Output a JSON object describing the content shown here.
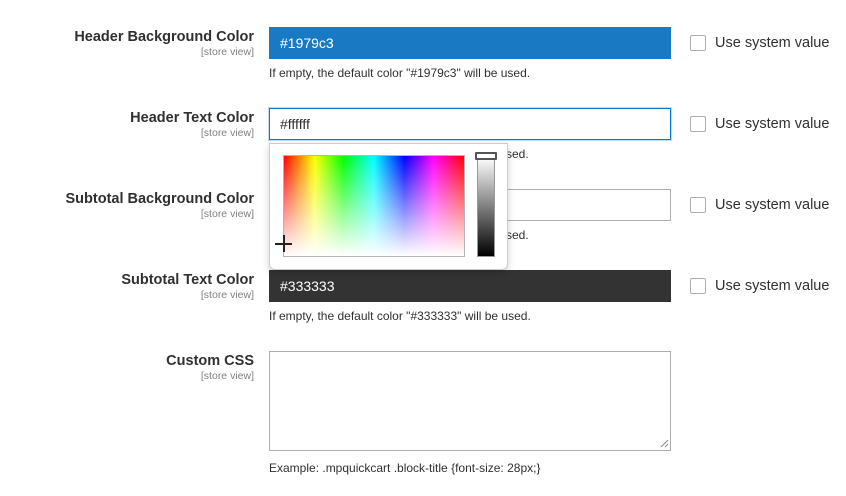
{
  "fields": [
    {
      "label": "Header Background Color",
      "scope": "[store view]",
      "value": "#1979c3",
      "note": "If empty, the default color \"#1979c3\" will be used.",
      "system_value_label": "Use system value"
    },
    {
      "label": "Header Text Color",
      "scope": "[store view]",
      "value": "#ffffff",
      "note_visible": "sed.",
      "system_value_label": "Use system value"
    },
    {
      "label": "Subtotal Background Color",
      "scope": "[store view]",
      "value": "",
      "note_visible": "sed.",
      "system_value_label": "Use system value"
    },
    {
      "label": "Subtotal Text Color",
      "scope": "[store view]",
      "value": "#333333",
      "note": "If empty, the default color \"#333333\" will be used.",
      "system_value_label": "Use system value"
    },
    {
      "label": "Custom CSS",
      "scope": "[store view]",
      "value": "",
      "note": "Example: .mpquickcart .block-title {font-size: 28px;}"
    }
  ],
  "colors": {
    "header_bg": "#1979c3",
    "subtotal_text_bg": "#333333",
    "focus_border": "#007bdb"
  },
  "color_picker": {
    "open_for": "Header Text Color"
  }
}
